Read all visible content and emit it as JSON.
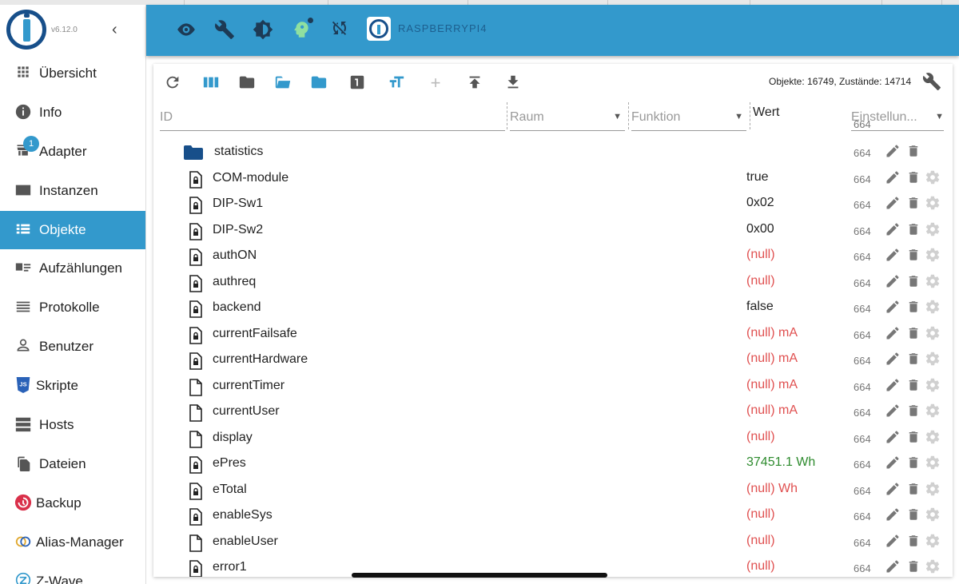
{
  "sidebar": {
    "version": "v6.12.0",
    "collapse_icon": "chevron-left-icon",
    "items": [
      {
        "label": "Übersicht",
        "icon": "grid-icon"
      },
      {
        "label": "Info",
        "icon": "info-icon"
      },
      {
        "label": "Adapter",
        "icon": "store-icon",
        "badge": "1"
      },
      {
        "label": "Instanzen",
        "icon": "instances-icon"
      },
      {
        "label": "Objekte",
        "icon": "list-icon",
        "active": true
      },
      {
        "label": "Aufzählungen",
        "icon": "enum-icon"
      },
      {
        "label": "Protokolle",
        "icon": "log-icon"
      },
      {
        "label": "Benutzer",
        "icon": "user-icon"
      },
      {
        "label": "Skripte",
        "icon": "js-icon"
      },
      {
        "label": "Hosts",
        "icon": "hosts-icon"
      },
      {
        "label": "Dateien",
        "icon": "files-icon"
      },
      {
        "label": "Backup",
        "icon": "backup-icon"
      },
      {
        "label": "Alias-Manager",
        "icon": "alias-icon"
      },
      {
        "label": "Z-Wave",
        "icon": "zwave-icon"
      }
    ]
  },
  "header": {
    "hostname": "RASPBERRYPI4",
    "icons": [
      "eye-icon",
      "wrench-icon",
      "brightness-icon",
      "expert-mode-icon",
      "sync-off-icon"
    ]
  },
  "toolbar": {
    "stats": "Objekte: 16749, Zustände: 14714",
    "icons": [
      "refresh-icon",
      "columns-icon",
      "folder-icon",
      "folder-open-icon",
      "folder-closed-icon",
      "number-one-icon",
      "text-size-icon",
      "add-icon",
      "upload-icon",
      "download-icon"
    ]
  },
  "filters": {
    "id_placeholder": "ID",
    "room_placeholder": "Raum",
    "function_placeholder": "Funktion",
    "value_header": "Wert",
    "settings_placeholder": "Einstellun..."
  },
  "colors": {
    "accent": "#3399cc",
    "null_red": "#e05050",
    "value_green": "#2e8b2e"
  },
  "rows": [
    {
      "name": "statistics",
      "type": "folder",
      "value": "",
      "unit": "",
      "color": "",
      "perm": "664",
      "gear": false
    },
    {
      "name": "COM-module",
      "type": "locked",
      "value": "true",
      "unit": "",
      "color": "#222",
      "perm": "664",
      "gear": true
    },
    {
      "name": "DIP-Sw1",
      "type": "locked",
      "value": "0x02",
      "unit": "",
      "color": "#222",
      "perm": "664",
      "gear": true
    },
    {
      "name": "DIP-Sw2",
      "type": "locked",
      "value": "0x00",
      "unit": "",
      "color": "#222",
      "perm": "664",
      "gear": true
    },
    {
      "name": "authON",
      "type": "locked",
      "value": "(null)",
      "unit": "",
      "color": "#e05050",
      "perm": "664",
      "gear": true
    },
    {
      "name": "authreq",
      "type": "locked",
      "value": "(null)",
      "unit": "",
      "color": "#e05050",
      "perm": "664",
      "gear": true
    },
    {
      "name": "backend",
      "type": "locked",
      "value": "false",
      "unit": "",
      "color": "#222",
      "perm": "664",
      "gear": true
    },
    {
      "name": "currentFailsafe",
      "type": "locked",
      "value": "(null)",
      "unit": "mA",
      "color": "#e05050",
      "perm": "664",
      "gear": true
    },
    {
      "name": "currentHardware",
      "type": "locked",
      "value": "(null)",
      "unit": "mA",
      "color": "#e05050",
      "perm": "664",
      "gear": true
    },
    {
      "name": "currentTimer",
      "type": "file",
      "value": "(null)",
      "unit": "mA",
      "color": "#e05050",
      "perm": "664",
      "gear": true
    },
    {
      "name": "currentUser",
      "type": "file",
      "value": "(null)",
      "unit": "mA",
      "color": "#e05050",
      "perm": "664",
      "gear": true
    },
    {
      "name": "display",
      "type": "file",
      "value": "(null)",
      "unit": "",
      "color": "#e05050",
      "perm": "664",
      "gear": true
    },
    {
      "name": "ePres",
      "type": "locked",
      "value": "37451.1",
      "unit": "Wh",
      "color": "#2e8b2e",
      "perm": "664",
      "gear": true
    },
    {
      "name": "eTotal",
      "type": "locked",
      "value": "(null)",
      "unit": "Wh",
      "color": "#e05050",
      "perm": "664",
      "gear": true
    },
    {
      "name": "enableSys",
      "type": "locked",
      "value": "(null)",
      "unit": "",
      "color": "#e05050",
      "perm": "664",
      "gear": true
    },
    {
      "name": "enableUser",
      "type": "file",
      "value": "(null)",
      "unit": "",
      "color": "#e05050",
      "perm": "664",
      "gear": true
    },
    {
      "name": "error1",
      "type": "locked",
      "value": "(null)",
      "unit": "",
      "color": "#e05050",
      "perm": "664",
      "gear": true
    }
  ]
}
